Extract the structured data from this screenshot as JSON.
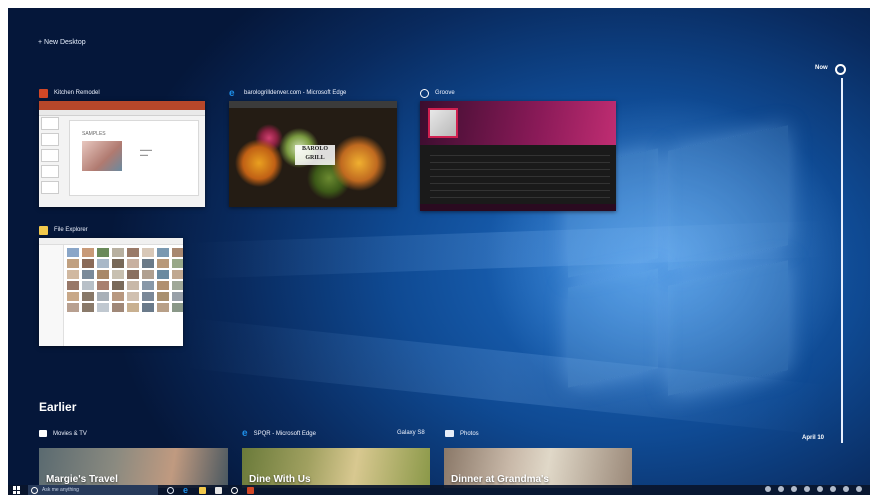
{
  "new_desktop": {
    "label": "+ New Desktop"
  },
  "windows": [
    {
      "title": "Kitchen Remodel",
      "icon": "powerpoint-icon",
      "color": "#d24726",
      "slide_title": "SAMPLES"
    },
    {
      "title": "barologrilldenver.com - Microsoft Edge",
      "icon": "edge-icon",
      "color": "#1e8fe8",
      "logo_text": "BAROLO GRILL"
    },
    {
      "title": "Groove",
      "icon": "groove-icon",
      "color": "#ffffff"
    },
    {
      "title": "File Explorer",
      "icon": "folder-icon",
      "color": "#f2c94c"
    }
  ],
  "timeline": {
    "now_label": "Now",
    "date_label": "April 10"
  },
  "earlier": {
    "heading": "Earlier",
    "cards": [
      {
        "app": "Movies & TV",
        "icon": "movies-tv-icon",
        "caption": "Margie's Travel"
      },
      {
        "app": "SPQR - Microsoft Edge",
        "extra": "Galaxy S8",
        "icon": "edge-icon",
        "caption": "Dine With Us"
      },
      {
        "app": "Photos",
        "icon": "photos-icon",
        "caption": "Dinner at Grandma's"
      }
    ]
  },
  "taskbar": {
    "search_placeholder": "Ask me anything"
  }
}
